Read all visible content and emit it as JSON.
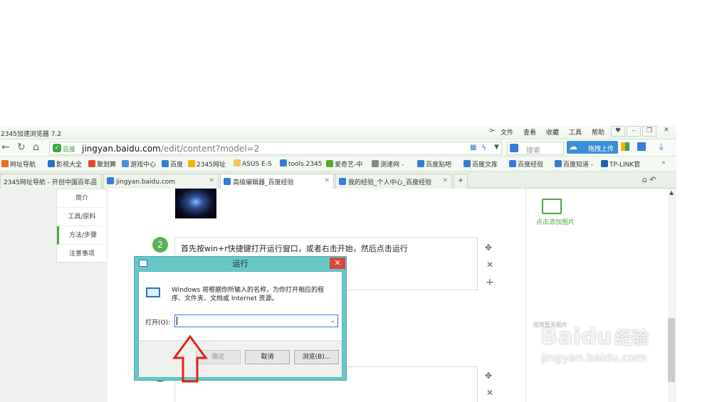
{
  "window": {
    "title": "2345加速浏览器 7.2",
    "menu": [
      "文件",
      "查看",
      "收藏",
      "工具",
      "帮助"
    ]
  },
  "address": {
    "safe_label": "百度",
    "url_host": "jingyan.baidu.com",
    "url_path": "/edit/content?model=2",
    "search_placeholder": "搜索",
    "upload_label": "拖拽上传"
  },
  "bookmarks": [
    "网址导航",
    "影视大全",
    "聚划算",
    "游戏中心",
    "百度",
    "2345网址",
    "ASUS E-S",
    "tools.2345",
    "爱奇艺-中",
    "测速网 -",
    "百度贴吧",
    "百度文库",
    "百度经验",
    "百度知道 -",
    "TP-LINK官"
  ],
  "tabs": [
    "2345网址导航 - 开创中国百年品",
    "jingyan.baidu.com",
    "高级编辑器_百度经验",
    "我的经验_个人中心_百度经验"
  ],
  "leftnav": [
    "简介",
    "工具/原料",
    "方法/步骤",
    "注意事项"
  ],
  "step": {
    "number": "2",
    "text": "首先按win+r快捷键打开运行窗口，或者右击开始，然后点击运行"
  },
  "right": {
    "add_image": "点击添加图片",
    "no_image": "图库暂无图片"
  },
  "dialog": {
    "title": "运行",
    "desc": "Windows 将根据你所输入的名称，为你打开相应的程序、文件夹、文档或 Internet 资源。",
    "open_label": "打开(O):",
    "ok": "确定",
    "cancel": "取消",
    "browse": "浏览(B)..."
  },
  "watermark": {
    "brand": "Bai",
    "brand2": "du",
    "brand3": "经验",
    "site": "jingyan.baidu.com"
  }
}
